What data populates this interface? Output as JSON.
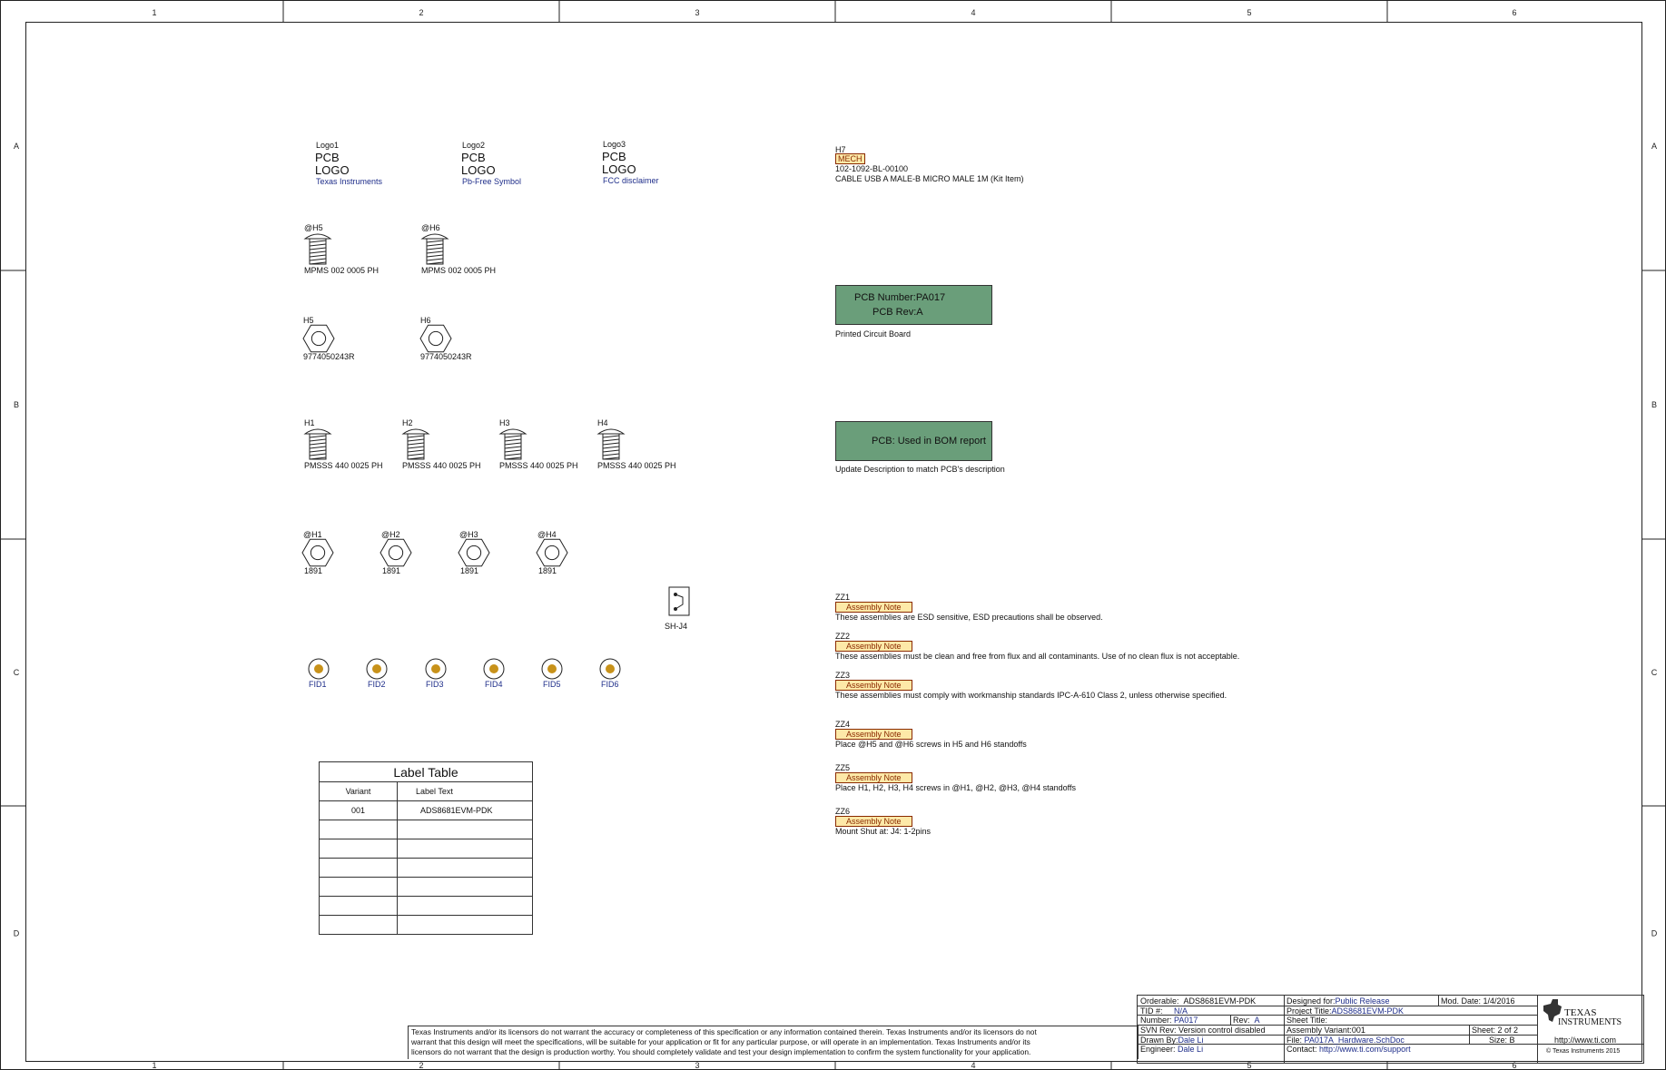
{
  "grid": {
    "cols": [
      "1",
      "2",
      "3",
      "4",
      "5",
      "6"
    ],
    "rows": [
      "A",
      "B",
      "C",
      "D"
    ]
  },
  "logos": [
    {
      "ref": "Logo1",
      "l1": "PCB",
      "l2": "LOGO",
      "desc": "Texas Instruments"
    },
    {
      "ref": "Logo2",
      "l1": "PCB",
      "l2": "LOGO",
      "desc": "Pb-Free Symbol"
    },
    {
      "ref": "Logo3",
      "l1": "PCB",
      "l2": "LOGO",
      "desc": "FCC disclaimer"
    }
  ],
  "screws_top": [
    {
      "ref": "@H5",
      "part": "MPMS 002 0005 PH"
    },
    {
      "ref": "@H6",
      "part": "MPMS 002 0005 PH"
    }
  ],
  "standoffs_top": [
    {
      "ref": "H5",
      "part": "9774050243R"
    },
    {
      "ref": "H6",
      "part": "9774050243R"
    }
  ],
  "screws_mid": [
    {
      "ref": "H1",
      "part": "PMSSS 440 0025 PH"
    },
    {
      "ref": "H2",
      "part": "PMSSS 440 0025 PH"
    },
    {
      "ref": "H3",
      "part": "PMSSS 440 0025 PH"
    },
    {
      "ref": "H4",
      "part": "PMSSS 440 0025 PH"
    }
  ],
  "standoffs_mid": [
    {
      "ref": "@H1",
      "part": "1891"
    },
    {
      "ref": "@H2",
      "part": "1891"
    },
    {
      "ref": "@H3",
      "part": "1891"
    },
    {
      "ref": "@H4",
      "part": "1891"
    }
  ],
  "shunt": {
    "ref": "SH-J4"
  },
  "fiducials": [
    "FID1",
    "FID2",
    "FID3",
    "FID4",
    "FID5",
    "FID6"
  ],
  "label_table": {
    "title": "Label Table",
    "col1": "Variant",
    "col2": "Label Text",
    "rows": [
      {
        "variant": "001",
        "text": "ADS8681EVM-PDK"
      }
    ]
  },
  "h7": {
    "ref": "H7",
    "tag": "MECH",
    "part": "102-1092-BL-00100",
    "desc": "CABLE USB A MALE-B MICRO MALE 1M (Kit Item)"
  },
  "pcb_box": {
    "line1": "PCB Number:PA017",
    "line2": "PCB Rev:A",
    "caption": "Printed Circuit Board"
  },
  "bom_box": {
    "text": "PCB: Used in BOM report",
    "caption": "Update Description to match PCB's description"
  },
  "notes": [
    {
      "ref": "ZZ1",
      "tag": "Assembly Note",
      "text": "These assemblies are ESD sensitive, ESD precautions shall be observed."
    },
    {
      "ref": "ZZ2",
      "tag": "Assembly Note",
      "text": "These assemblies must be clean and free from flux and all contaminants. Use of no clean flux is not acceptable."
    },
    {
      "ref": "ZZ3",
      "tag": "Assembly Note",
      "text": "These assemblies must comply with workmanship standards IPC-A-610 Class 2, unless otherwise specified."
    },
    {
      "ref": "ZZ4",
      "tag": "Assembly Note",
      "text": "Place @H5 and @H6 screws in H5 and H6 standoffs"
    },
    {
      "ref": "ZZ5",
      "tag": "Assembly Note",
      "text": "Place H1, H2, H3, H4 screws in @H1, @H2, @H3, @H4 standoffs"
    },
    {
      "ref": "ZZ6",
      "tag": "Assembly Note",
      "text": "Mount Shut at: J4: 1-2pins"
    }
  ],
  "disclaimer": [
    "Texas Instruments and/or its licensors do not warrant the accuracy or completeness of this specification or any information contained therein. Texas Instruments and/or its licensors do not",
    "warrant that this design will meet the specifications, will be suitable for your application or fit for any particular purpose, or will operate in an implementation. Texas Instruments and/or its",
    "licensors do not warrant that the design is production worthy. You should completely validate and test your design implementation to confirm the system functionality for your application."
  ],
  "title_block": {
    "orderable_label": "Orderable:",
    "orderable": "ADS8681EVM-PDK",
    "tid_label": "TID #:",
    "tid": "N/A",
    "number_label": "Number:",
    "number": "PA017",
    "rev_label": "Rev:",
    "rev": "A",
    "svn": "SVN Rev: Version control disabled",
    "drawn_label": "Drawn By:",
    "drawn": "Dale Li",
    "engineer_label": "Engineer:",
    "engineer": "Dale Li",
    "designed_label": "Designed for:",
    "designed": "Public Release",
    "moddate": "Mod. Date: 1/4/2016",
    "project_label": "Project Title:",
    "project": "ADS8681EVM-PDK",
    "sheet_title": "Sheet Title:",
    "variant": "Assembly Variant:001",
    "sheet": "Sheet: 2  of  2",
    "file_label": "File:",
    "file": "PA017A_Hardware.SchDoc",
    "size": "Size: B",
    "contact_label": "Contact:",
    "contact": "http://www.ti.com/support",
    "url": "http://www.ti.com",
    "copyright": "© Texas Instruments 2015",
    "logo_l1": "TEXAS",
    "logo_l2": "INSTRUMENTS"
  }
}
